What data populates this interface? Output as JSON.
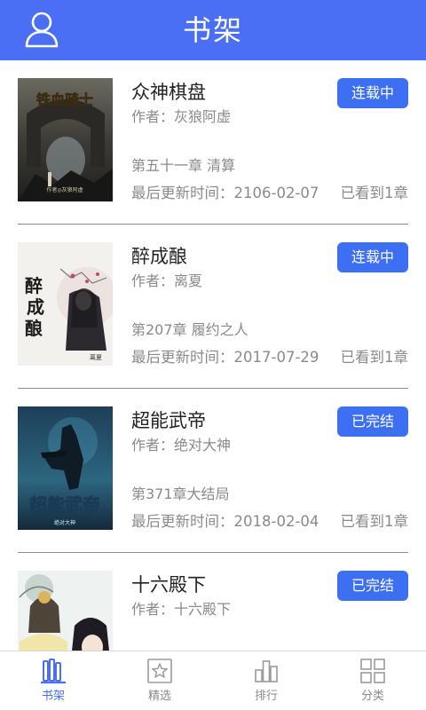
{
  "header": {
    "title": "书架",
    "user_icon": "user-icon"
  },
  "colors": {
    "primary": "#4a6ff4",
    "badge": "#3d6ff3",
    "text_main": "#222222",
    "text_muted": "#8a8a8a"
  },
  "books": [
    {
      "title": "众神棋盘",
      "author": "作者：灰狼阿虚",
      "chapter": "第五十一章 清算",
      "updated": "最后更新时间：2106-02-07",
      "progress": "已看到1章",
      "status": "连载中",
      "cover_text": "铁血骑士",
      "cover_sub": "作者◎灰狼阿虚"
    },
    {
      "title": "醉成酿",
      "author": "作者：离夏",
      "chapter": "第207章  履约之人",
      "updated": "最后更新时间：2017-07-29",
      "progress": "已看到1章",
      "status": "连载中",
      "cover_text": "醉成酿",
      "cover_sub": "离夏"
    },
    {
      "title": "超能武帝",
      "author": "作者：绝对大神",
      "chapter": "第371章大结局",
      "updated": "最后更新时间：2018-02-04",
      "progress": "已看到1章",
      "status": "已完结",
      "cover_text": "超能武帝",
      "cover_sub": "绝对大神"
    },
    {
      "title": "十六殿下",
      "author": "作者：十六殿下",
      "chapter": "",
      "updated": "",
      "progress": "",
      "status": "已完结"
    }
  ],
  "nav": [
    {
      "label": "书架",
      "icon": "bookshelf-icon",
      "active": true
    },
    {
      "label": "精选",
      "icon": "star-icon",
      "active": false
    },
    {
      "label": "排行",
      "icon": "ranking-icon",
      "active": false
    },
    {
      "label": "分类",
      "icon": "category-grid-icon",
      "active": false
    }
  ]
}
